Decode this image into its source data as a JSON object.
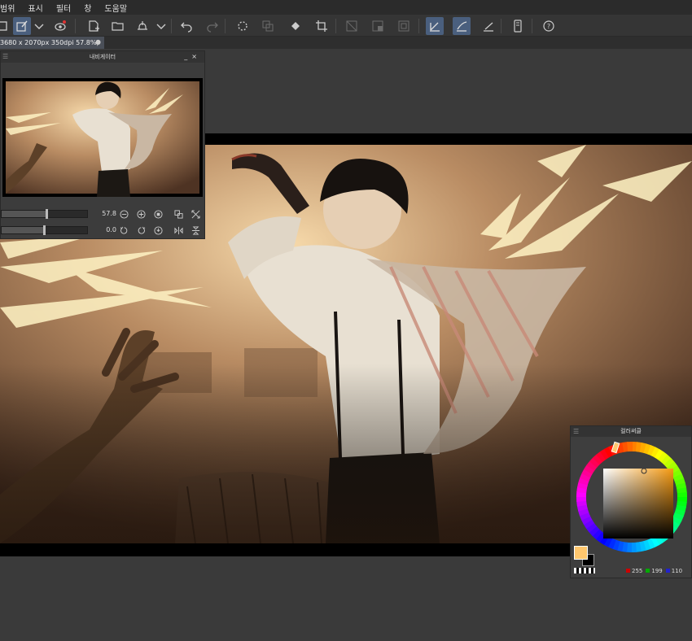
{
  "menu": [
    "범위",
    "표시",
    "필터",
    "창",
    "도움말"
  ],
  "toolbar_icons": [
    "layer-icon",
    "new-layer-icon",
    "dropdown-icon",
    "eye-icon",
    "new-file-icon",
    "open-folder-icon",
    "export-icon",
    "dropdown-icon",
    "undo-icon",
    "redo-icon",
    "select-loading-icon",
    "copy-icon",
    "fill-icon",
    "crop-icon",
    "mask-icon",
    "gradient-icon",
    "frame-icon",
    "pen-snap-icon",
    "brush-snap-icon",
    "ruler-icon",
    "phone-icon",
    "help-icon"
  ],
  "document_tab": {
    "label": "3680 x 2070px 350dpi 57.8%)",
    "close": "●"
  },
  "navigator": {
    "title": "내비게이터",
    "zoom_value": "57.8",
    "rotate_value": "0.0",
    "zoom_fraction": 0.51,
    "rotate_fraction": 0.49
  },
  "color_wheel": {
    "title": "컬러써클",
    "r": "255",
    "g": "199",
    "b": "110",
    "fg_color": "#ffc76e",
    "bg_color": "#000000"
  }
}
